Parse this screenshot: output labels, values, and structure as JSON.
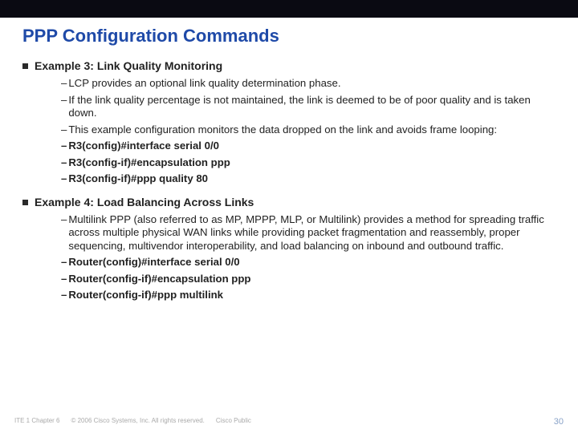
{
  "title": "PPP Configuration Commands",
  "example3": {
    "heading": "Example 3: Link Quality Monitoring",
    "b1": "LCP provides an optional link quality determination phase.",
    "b2": "If the link quality percentage is not maintained, the link is deemed to be of poor quality and is taken down.",
    "b3": "This example configuration monitors the data dropped on the link and avoids frame looping:",
    "c1": "R3(config)#interface serial 0/0",
    "c2": "R3(config-if)#encapsulation ppp",
    "c3": "R3(config-if)#ppp quality 80"
  },
  "example4": {
    "heading": "Example 4: Load Balancing Across Links",
    "b1": "Multilink PPP (also referred to as MP, MPPP, MLP, or Multilink) provides a method for spreading traffic across multiple physical WAN links while providing packet fragmentation and reassembly, proper sequencing, multivendor interoperability, and load balancing on inbound and outbound traffic.",
    "c1": "Router(config)#interface serial 0/0",
    "c2": "Router(config-if)#encapsulation ppp",
    "c3": "Router(config-if)#ppp multilink"
  },
  "footer": {
    "left1": "ITE 1 Chapter 6",
    "left2": "© 2006 Cisco Systems, Inc. All rights reserved.",
    "left3": "Cisco Public",
    "page": "30"
  }
}
